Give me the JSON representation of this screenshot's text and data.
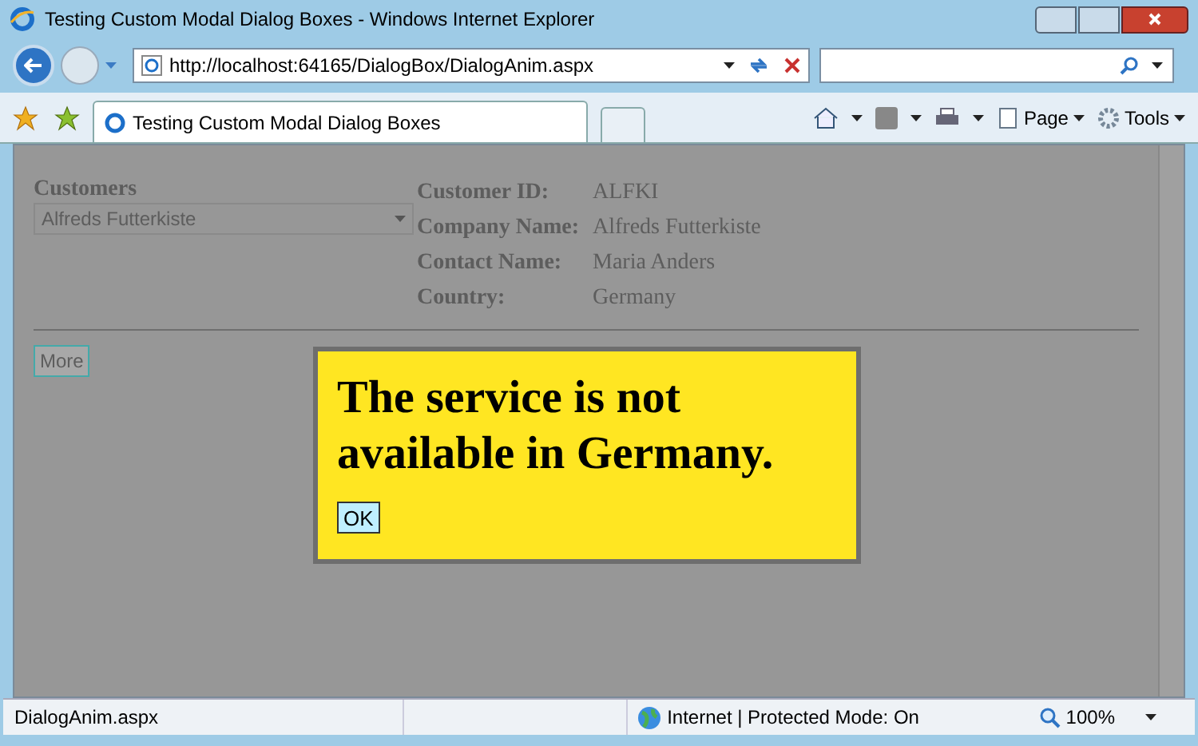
{
  "window": {
    "title": "Testing Custom Modal Dialog Boxes - Windows Internet Explorer"
  },
  "address_bar": {
    "url": "http://localhost:64165/DialogBox/DialogAnim.aspx"
  },
  "tab": {
    "title": "Testing Custom Modal Dialog Boxes",
    "selected": true
  },
  "command_bar": [
    {
      "label": "Page"
    },
    {
      "label": "Tools"
    }
  ],
  "page": {
    "customers_label": "Customers",
    "customers_select": "Alfreds Futterkiste",
    "details": [
      {
        "label": "Customer ID:",
        "value": "ALFKI"
      },
      {
        "label": "Company Name:",
        "value": "Alfreds Futterkiste"
      },
      {
        "label": "Contact Name:",
        "value": "Maria Anders"
      },
      {
        "label": "Country:",
        "value": "Germany"
      }
    ],
    "more_button": "More"
  },
  "dialog": {
    "message": "The service is not available in Germany.",
    "ok_button": "OK"
  },
  "status_bar": {
    "text": "DialogAnim.aspx",
    "zone": "Internet | Protected Mode: On",
    "zoom": "100%"
  }
}
